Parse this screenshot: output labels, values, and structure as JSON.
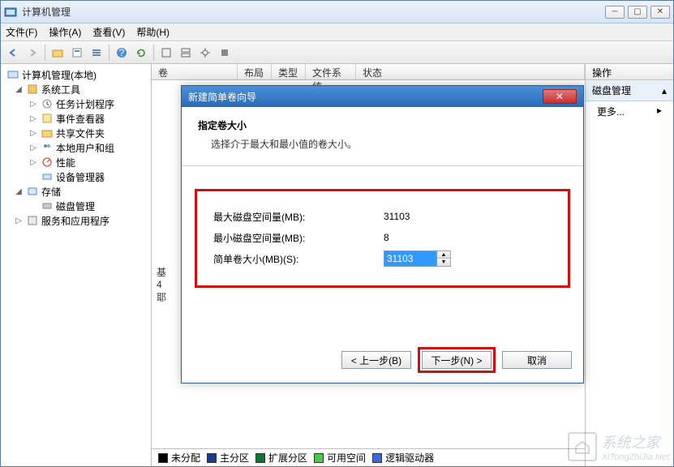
{
  "window": {
    "title": "计算机管理"
  },
  "menu": {
    "file": "文件(F)",
    "action": "操作(A)",
    "view": "查看(V)",
    "help": "帮助(H)"
  },
  "tree": {
    "root": "计算机管理(本地)",
    "systools": "系统工具",
    "scheduler": "任务计划程序",
    "eventviewer": "事件查看器",
    "shared": "共享文件夹",
    "users": "本地用户和组",
    "perf": "性能",
    "devmgr": "设备管理器",
    "storage": "存储",
    "diskmgmt": "磁盘管理",
    "services": "服务和应用程序"
  },
  "columns": {
    "volume": "卷",
    "layout": "布局",
    "type": "类型",
    "fs": "文件系统",
    "status": "状态"
  },
  "legend": {
    "unalloc": "未分配",
    "primary": "主分区",
    "extended": "扩展分区",
    "free": "可用空间",
    "logical": "逻辑驱动器"
  },
  "actions": {
    "header": "操作",
    "diskmgmt": "磁盘管理",
    "more": "更多..."
  },
  "dialog": {
    "title": "新建简单卷向导",
    "heading": "指定卷大小",
    "sub": "选择介于最大和最小值的卷大小。",
    "max_label": "最大磁盘空间量(MB):",
    "max_value": "31103",
    "min_label": "最小磁盘空间量(MB):",
    "min_value": "8",
    "size_label": "简单卷大小(MB)(S):",
    "size_value": "31103",
    "back": "< 上一步(B)",
    "next": "下一步(N) >",
    "cancel": "取消"
  },
  "watermark": {
    "text1": "系统之家",
    "text2": "XiTongZhiJia.Net"
  }
}
